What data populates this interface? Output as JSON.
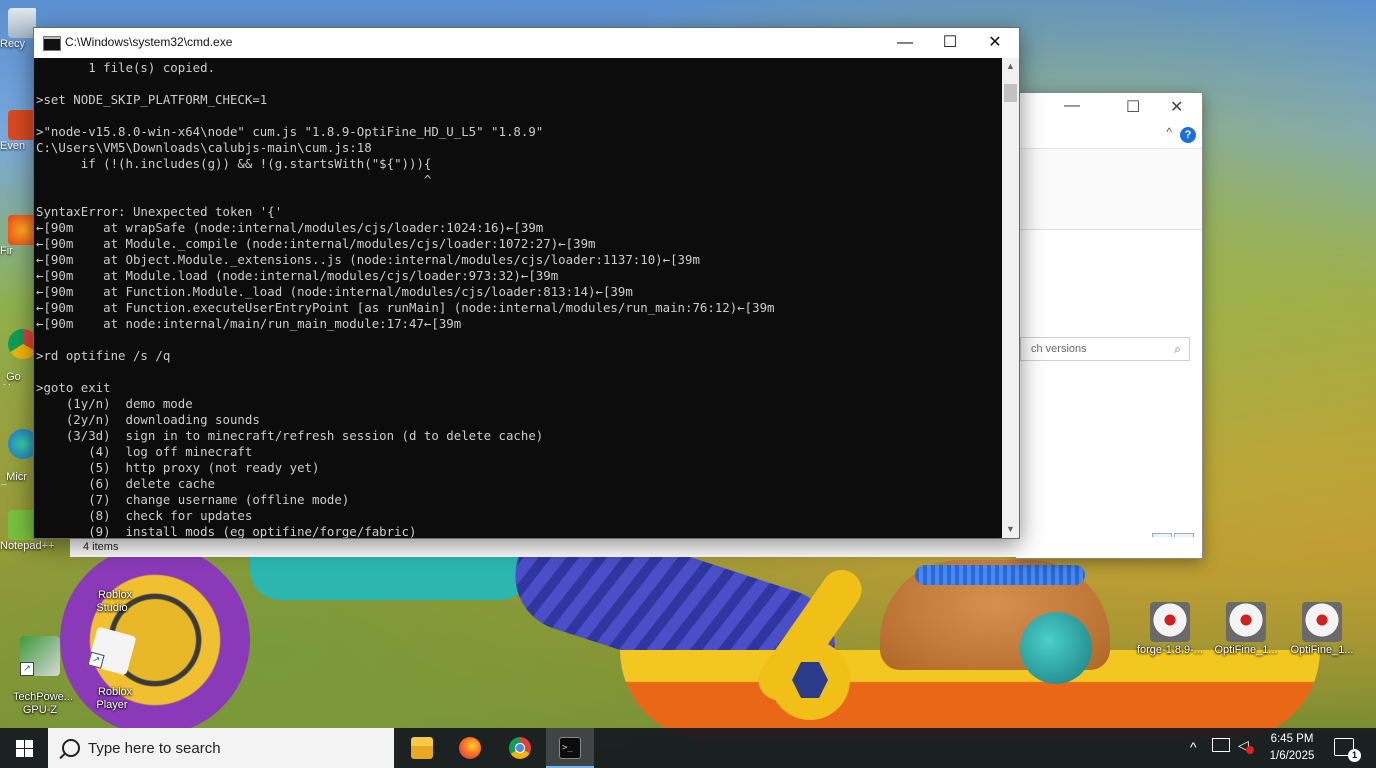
{
  "cmd": {
    "title": "C:\\Windows\\system32\\cmd.exe",
    "minimize": "—",
    "maximize": "☐",
    "close": "✕",
    "lines": [
      "       1 file(s) copied.",
      "",
      ">set NODE_SKIP_PLATFORM_CHECK=1",
      "",
      ">\"node-v15.8.0-win-x64\\node\" cum.js \"1.8.9-OptiFine_HD_U_L5\" \"1.8.9\"",
      "C:\\Users\\VM5\\Downloads\\calubjs-main\\cum.js:18",
      "      if (!(h.includes(g)) && !(g.startsWith(\"${\"))){",
      "                                                    ^",
      "",
      "SyntaxError: Unexpected token '{'",
      "←[90m    at wrapSafe (node:internal/modules/cjs/loader:1024:16)←[39m",
      "←[90m    at Module._compile (node:internal/modules/cjs/loader:1072:27)←[39m",
      "←[90m    at Object.Module._extensions..js (node:internal/modules/cjs/loader:1137:10)←[39m",
      "←[90m    at Module.load (node:internal/modules/cjs/loader:973:32)←[39m",
      "←[90m    at Function.Module._load (node:internal/modules/cjs/loader:813:14)←[39m",
      "←[90m    at Function.executeUserEntryPoint [as runMain] (node:internal/modules/run_main:76:12)←[39m",
      "←[90m    at node:internal/main/run_main_module:17:47←[39m",
      "",
      ">rd optifine /s /q",
      "",
      ">goto exit",
      "    (1y/n)  demo mode",
      "    (2y/n)  downloading sounds",
      "    (3/3d)  sign in to minecraft/refresh session (d to delete cache)",
      "       (4)  log off minecraft",
      "       (5)  http proxy (not ready yet)",
      "       (6)  delete cache",
      "       (7)  change username (offline mode)",
      "       (8)  check for updates",
      "       (9)  install mods (eg optifine/forge/fabric)"
    ]
  },
  "explorer": {
    "search_placeholder": "ch versions",
    "status": "4 items",
    "minimize": "—",
    "maximize": "☐",
    "close": "✕",
    "help": "?",
    "caret": "^"
  },
  "desktop": {
    "left_labels": [
      "Recy",
      "Even",
      "Fir",
      "Go\nChr",
      "Micr\nE",
      "Notepad++"
    ],
    "icons": [
      {
        "label": "Roblox\nStudio"
      },
      {
        "label": "TechPowe...\nGPU-Z"
      },
      {
        "label": "Roblox\nPlayer"
      },
      {
        "label": "forge-1.8.9-..."
      },
      {
        "label": "OptiFine_1..."
      },
      {
        "label": "OptiFine_1..."
      }
    ]
  },
  "taskbar": {
    "search_placeholder": "Type here to search",
    "time": "6:45 PM",
    "date": "1/6/2025",
    "notification_count": "1"
  },
  "colors": {
    "console_bg": "#0c0c0c",
    "console_text": "#cccccc",
    "taskbar_bg": "#14181f"
  }
}
